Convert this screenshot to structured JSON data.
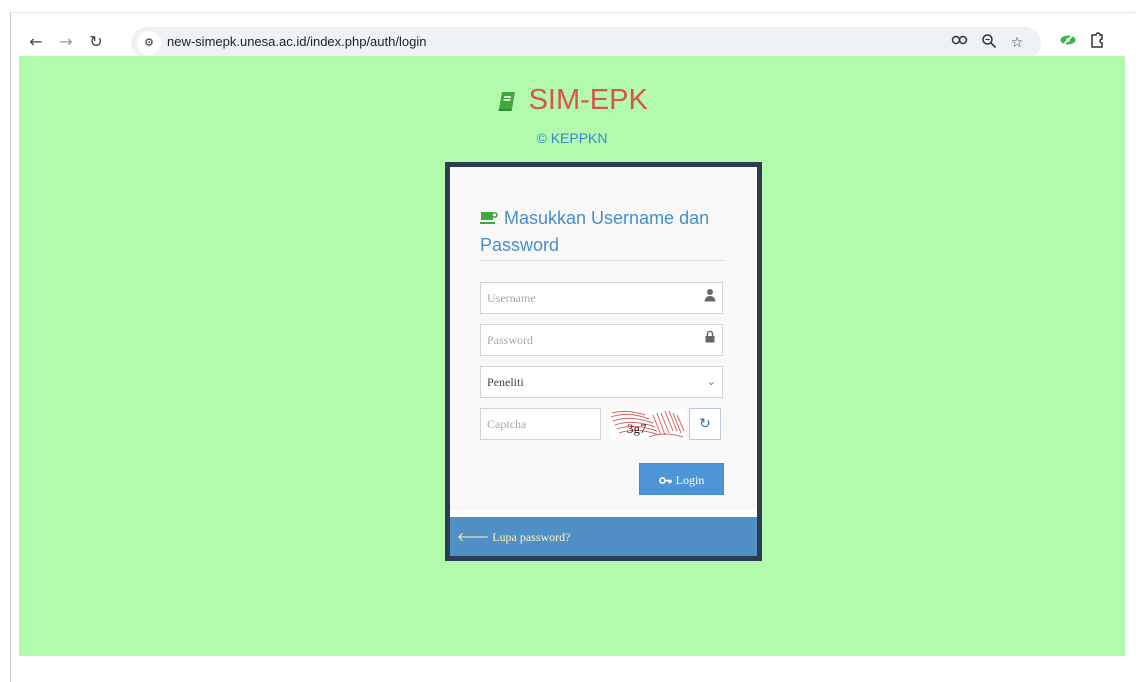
{
  "browser": {
    "url": "new-simepk.unesa.ac.id/index.php/auth/login",
    "back_icon": "arrow-left-icon",
    "forward_icon": "arrow-right-icon",
    "reload_icon": "reload-icon",
    "site_info_icon": "tune-icon",
    "password_key_icon": "key-icon",
    "zoom_icon": "zoom-icon",
    "bookmark_icon": "star-icon",
    "extension_icon": "eye-off-icon",
    "extensions_icon": "puzzle-icon"
  },
  "brand": {
    "title": "SIM-EPK",
    "copyright": "© KEPPKN",
    "title_color": "#d9534f",
    "icon": "book-icon"
  },
  "login": {
    "heading": "Masukkan Username dan Password",
    "heading_icon": "coffee-icon",
    "username_placeholder": "Username",
    "password_placeholder": "Password",
    "role_selected": "Peneliti",
    "captcha_placeholder": "Captcha",
    "captcha_text": "3g7",
    "refresh_icon": "refresh-icon",
    "login_label": "Login",
    "login_icon": "key-icon",
    "forgot_label": "Lupa password?",
    "forgot_icon": "arrow-left-icon"
  },
  "colors": {
    "page_background": "#b2fbad",
    "box_border": "#2f3b52",
    "accent_blue": "#478fca",
    "button_blue": "#4d95d6",
    "footer_blue": "#5090c5",
    "link_yellow": "#fff3b8"
  }
}
